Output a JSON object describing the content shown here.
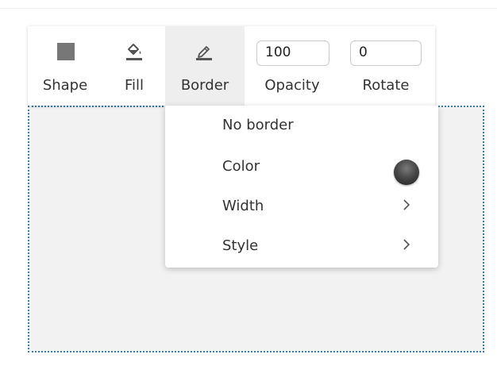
{
  "toolbar": {
    "shape_label": "Shape",
    "fill_label": "Fill",
    "border_label": "Border",
    "opacity_label": "Opacity",
    "opacity_value": "100",
    "rotate_label": "Rotate",
    "rotate_value": "0",
    "shape_icon": "square-icon",
    "fill_icon": "paint-bucket-icon",
    "border_icon": "pencil-icon"
  },
  "border_menu": {
    "items": [
      {
        "label": "No border"
      },
      {
        "label": "Color",
        "swatch_color": "#3a3a3a"
      },
      {
        "label": "Width",
        "submenu": true
      },
      {
        "label": "Style",
        "submenu": true
      }
    ]
  },
  "colors": {
    "shape_fill": "#f2f2f2",
    "selection_border": "#3b7fa6",
    "active_tab": "#eeeeee"
  }
}
